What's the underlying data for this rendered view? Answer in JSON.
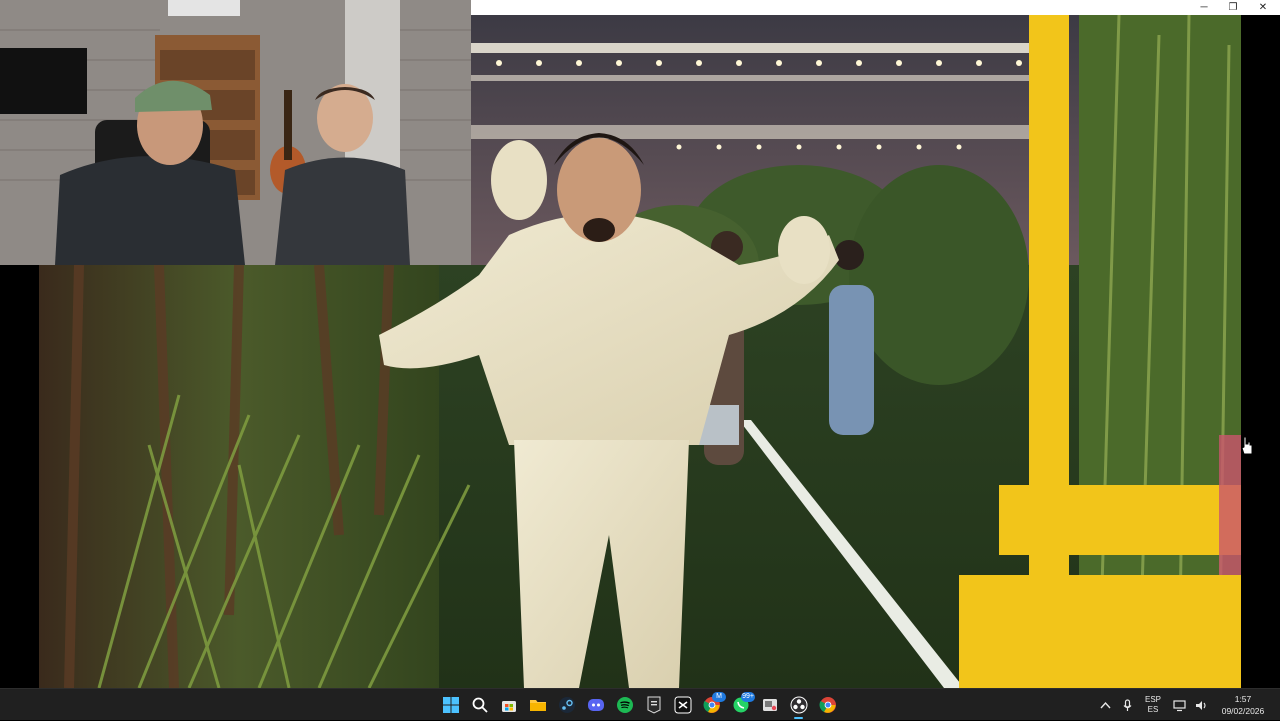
{
  "window": {
    "controls": {
      "minimize": "─",
      "maximize": "❐",
      "close": "✕"
    }
  },
  "video": {
    "kind": "music-video-stadium-scene"
  },
  "webcam": {
    "kind": "streamer-facecam"
  },
  "taskbar": {
    "apps": [
      {
        "id": "start",
        "icon": "windows-start-icon",
        "active": false
      },
      {
        "id": "search",
        "icon": "search-icon",
        "active": false
      },
      {
        "id": "store",
        "icon": "store-icon",
        "active": false
      },
      {
        "id": "explorer",
        "icon": "folder-icon",
        "active": false
      },
      {
        "id": "steam",
        "icon": "steam-icon",
        "active": false
      },
      {
        "id": "discord",
        "icon": "discord-icon",
        "active": false
      },
      {
        "id": "spotify",
        "icon": "spotify-icon",
        "active": false
      },
      {
        "id": "epic",
        "icon": "epic-games-icon",
        "active": false
      },
      {
        "id": "capcut",
        "icon": "capcut-icon",
        "active": false
      },
      {
        "id": "chrome-profile",
        "icon": "chrome-icon",
        "active": false,
        "badge": "M"
      },
      {
        "id": "whatsapp",
        "icon": "whatsapp-icon",
        "active": false,
        "badge": "99+"
      },
      {
        "id": "snipping",
        "icon": "snipping-tool-icon",
        "active": false
      },
      {
        "id": "obs",
        "icon": "obs-icon",
        "active": true
      },
      {
        "id": "chrome",
        "icon": "chrome-icon",
        "active": false
      }
    ],
    "tray": {
      "lang_top": "ESP",
      "lang_bottom": "ES",
      "time": "1:57",
      "date": "09/02/2026"
    }
  },
  "colors": {
    "taskbar_bg": "#202020",
    "accent": "#4cc2ff",
    "field_green": "#2f4a24",
    "suit_cream": "#e8e0c4",
    "booth_yellow": "#f2c51a"
  }
}
